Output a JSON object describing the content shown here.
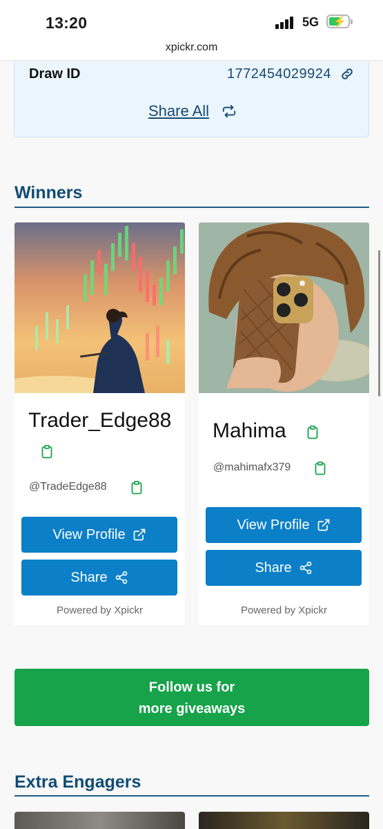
{
  "status": {
    "time": "13:20",
    "network": "5G"
  },
  "browser": {
    "url": "xpickr.com"
  },
  "draw": {
    "label": "Draw ID",
    "value": "1772454029924",
    "share_all": "Share All"
  },
  "winners": {
    "title": "Winners",
    "cards": [
      {
        "name": "Trader_Edge88",
        "handle": "@TradeEdge88",
        "view_profile": "View Profile",
        "share": "Share",
        "powered": "Powered by Xpickr"
      },
      {
        "name": "Mahima",
        "handle": "@mahimafx379",
        "view_profile": "View Profile",
        "share": "Share",
        "powered": "Powered by Xpickr"
      }
    ]
  },
  "follow": {
    "line1": "Follow us for",
    "line2": "more giveaways"
  },
  "extra": {
    "title": "Extra Engagers"
  },
  "colors": {
    "primary_button": "#0b7fc7",
    "follow_green": "#16a34a",
    "heading_blue": "#0f4c75",
    "clipboard_green": "#16a34a"
  }
}
